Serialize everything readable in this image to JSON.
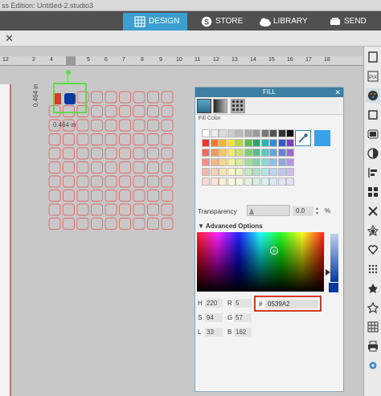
{
  "app": {
    "title": "ss Edition: Untitled-2.studio3"
  },
  "nav_tabs": {
    "design": "DESIGN",
    "store": "STORE",
    "library": "LIBRARY",
    "send": "SEND",
    "active": "DESIGN",
    "active_color": "#3d9fd0"
  },
  "ruler": {
    "labels": [
      "12",
      "2",
      "4",
      "5",
      "6",
      "7",
      "8",
      "9",
      "10",
      "11",
      "12",
      "13",
      "14",
      "15",
      "16",
      "17",
      "18"
    ]
  },
  "selection": {
    "width_label": "0.464 in",
    "height_label": "0.464 in",
    "outline_color": "#5fd94a"
  },
  "design_grid": {
    "columns": 9,
    "rows": 10,
    "cell_outline_color": "#e06a6a"
  },
  "fill_panel": {
    "title": "FILL",
    "close": "✕",
    "fill_color_label": "Fill Color",
    "current_color": "#3aa0e8",
    "transparency_label": "Transparency",
    "transparency_value": "0.0",
    "transparency_unit": "%",
    "advanced_options_label": "Advanced Options",
    "fields": {
      "h_label": "H",
      "h_value": "220",
      "r_label": "R",
      "r_value": "5",
      "s_label": "S",
      "s_value": "94",
      "g_label": "G",
      "g_value": "57",
      "l_label": "L",
      "l_value": "33",
      "b_label": "B",
      "b_value": "162"
    },
    "hex_hash": "#",
    "hex_value": "0539A2",
    "hex_highlight_color": "#d23a28"
  },
  "swatches": {
    "rows": [
      [
        "#ffffff",
        "#eeeeee",
        "#dddddd",
        "#cccccc",
        "#bbbbbb",
        "#aaaaaa",
        "#999999",
        "#777777",
        "#555555",
        "#333333",
        "#111111"
      ],
      [
        "#e63b2e",
        "#f27a2a",
        "#f5b52c",
        "#f7e23a",
        "#b7d93a",
        "#58c04a",
        "#2fa66a",
        "#2bb6b0",
        "#2e8fd8",
        "#3357c8",
        "#7a3fc0"
      ],
      [
        "#ee6a5e",
        "#f59a5a",
        "#f8c75e",
        "#f9ea6c",
        "#cbe46c",
        "#7fd070",
        "#5bbd8a",
        "#5ac8c2",
        "#5ea9e2",
        "#6580d6",
        "#9a6ad0"
      ],
      [
        "#f39088",
        "#f8b688",
        "#fad68a",
        "#fbf09a",
        "#dcee96",
        "#a2de9a",
        "#86d0a8",
        "#87d8d2",
        "#8ac0ea",
        "#93a6e2",
        "#b694de"
      ],
      [
        "#f7b6b0",
        "#fbd0b2",
        "#fce4b4",
        "#fdf6c2",
        "#eaf4be",
        "#c4eac2",
        "#b0e0c8",
        "#b2e6e2",
        "#b6d6f2",
        "#bec8ee",
        "#d2bcea"
      ],
      [
        "#fbd8d4",
        "#fde4d6",
        "#fef0d8",
        "#fefae2",
        "#f4fae0",
        "#e0f4e0",
        "#d6f0e4",
        "#d8f2f0",
        "#dae8f8",
        "#dee4f6",
        "#e8ddf4"
      ]
    ]
  },
  "right_toolbar": {
    "icons": [
      "page-icon",
      "pixscan-icon",
      "fill-color-icon",
      "line-color-icon",
      "shadow-icon",
      "transparency-icon",
      "align-icon",
      "replicate-icon",
      "modify-icon",
      "offset-icon",
      "trace-icon",
      "rhinestone-icon",
      "sketch-icon",
      "star-icon",
      "grid-icon",
      "print-icon",
      "gear-icon"
    ]
  }
}
